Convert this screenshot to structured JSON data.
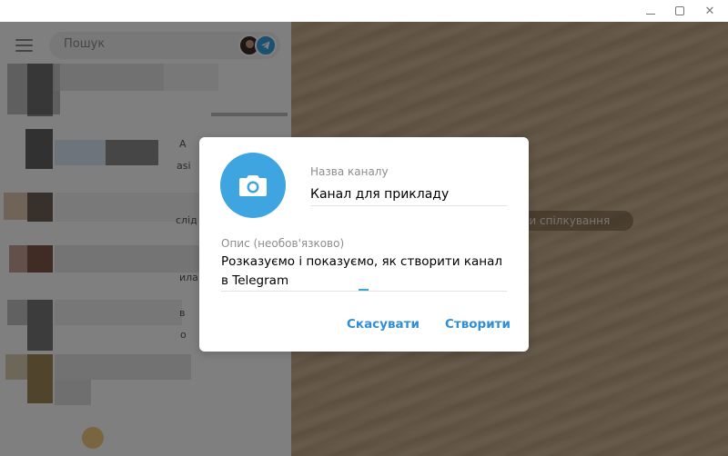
{
  "window": {
    "minimize_icon": "minimize-icon",
    "maximize_icon": "maximize-icon",
    "close_icon": "close-icon",
    "close_glyph": "✕"
  },
  "sidebar": {
    "search_placeholder": "Пошук",
    "menu_icon": "hamburger-menu-icon",
    "chat_fragments": [
      "А",
      "asi ",
      "слід",
      "ила",
      "в",
      "о"
    ]
  },
  "background": {
    "action_pill": "вати спілкування"
  },
  "dialog": {
    "photo_icon": "camera-icon",
    "name_label": "Назва каналу",
    "name_value": "Канал для прикладу",
    "description_label": "Опис (необов'язково)",
    "description_value": "Розказуємо і показуємо, як створити канал в Telegram",
    "cancel_label": "Скасувати",
    "create_label": "Створити"
  },
  "colors": {
    "accent": "#3fa5e0",
    "link": "#2e8fd8",
    "overlay": "rgba(0,0,0,0.5)"
  }
}
